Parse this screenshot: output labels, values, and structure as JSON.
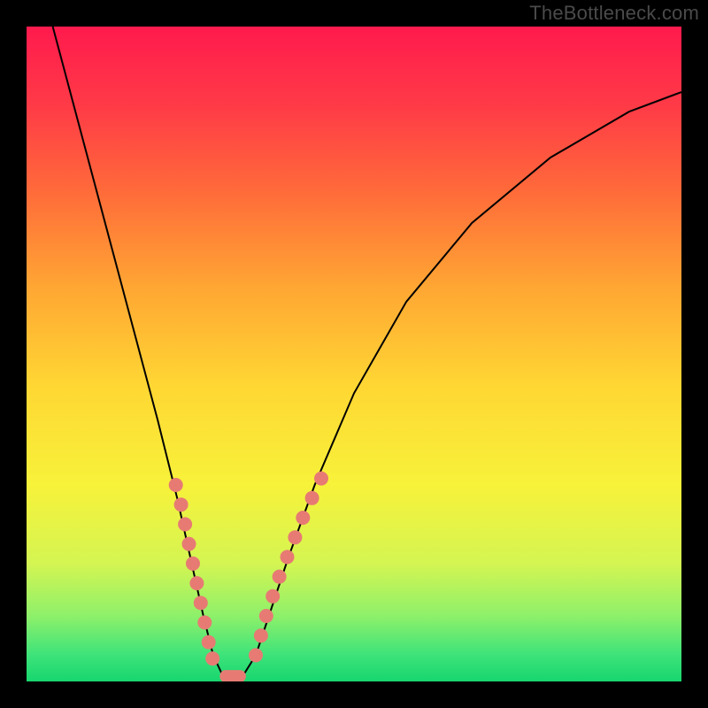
{
  "watermark": "TheBottleneck.com",
  "chart_data": {
    "type": "line",
    "title": "",
    "xlabel": "",
    "ylabel": "",
    "xlim": [
      0,
      100
    ],
    "ylim": [
      0,
      100
    ],
    "grid": false,
    "notes": "Vertical rainbow gradient background (red top → green bottom) with black V-shaped curve. Left arm starts top-left, right arm asymptotes near top-right. Salmon dot markers along lower portion of both arms and a short flat segment at the bottom (vertex).",
    "series": [
      {
        "name": "curve",
        "style": "black-line",
        "points": [
          {
            "x": 4,
            "y": 100
          },
          {
            "x": 8,
            "y": 85
          },
          {
            "x": 12,
            "y": 70
          },
          {
            "x": 16,
            "y": 55
          },
          {
            "x": 20,
            "y": 40
          },
          {
            "x": 23,
            "y": 28
          },
          {
            "x": 25,
            "y": 19
          },
          {
            "x": 27,
            "y": 10
          },
          {
            "x": 28.5,
            "y": 4
          },
          {
            "x": 30,
            "y": 0.8
          },
          {
            "x": 33,
            "y": 0.8
          },
          {
            "x": 35,
            "y": 4
          },
          {
            "x": 37,
            "y": 10
          },
          {
            "x": 40,
            "y": 19
          },
          {
            "x": 44,
            "y": 30
          },
          {
            "x": 50,
            "y": 44
          },
          {
            "x": 58,
            "y": 58
          },
          {
            "x": 68,
            "y": 70
          },
          {
            "x": 80,
            "y": 80
          },
          {
            "x": 92,
            "y": 87
          },
          {
            "x": 100,
            "y": 90
          }
        ]
      },
      {
        "name": "markers-left-arm",
        "style": "salmon-dots",
        "points": [
          {
            "x": 22.8,
            "y": 30
          },
          {
            "x": 23.6,
            "y": 27
          },
          {
            "x": 24.2,
            "y": 24
          },
          {
            "x": 24.8,
            "y": 21
          },
          {
            "x": 25.4,
            "y": 18
          },
          {
            "x": 26.0,
            "y": 15
          },
          {
            "x": 26.6,
            "y": 12
          },
          {
            "x": 27.2,
            "y": 9
          },
          {
            "x": 27.8,
            "y": 6
          },
          {
            "x": 28.4,
            "y": 3.5
          }
        ]
      },
      {
        "name": "markers-right-arm",
        "style": "salmon-dots",
        "points": [
          {
            "x": 35.0,
            "y": 4
          },
          {
            "x": 35.8,
            "y": 7
          },
          {
            "x": 36.6,
            "y": 10
          },
          {
            "x": 37.6,
            "y": 13
          },
          {
            "x": 38.6,
            "y": 16
          },
          {
            "x": 39.8,
            "y": 19
          },
          {
            "x": 41.0,
            "y": 22
          },
          {
            "x": 42.2,
            "y": 25
          },
          {
            "x": 43.6,
            "y": 28
          },
          {
            "x": 45.0,
            "y": 31
          }
        ]
      },
      {
        "name": "markers-vertex",
        "style": "salmon-bar",
        "points": [
          {
            "x": 29.5,
            "y": 0.8
          },
          {
            "x": 33.5,
            "y": 0.8
          }
        ]
      }
    ],
    "background_gradient_stops": [
      {
        "offset": 0.0,
        "color": "#ff1a4d"
      },
      {
        "offset": 0.12,
        "color": "#ff3a47"
      },
      {
        "offset": 0.25,
        "color": "#ff6a3a"
      },
      {
        "offset": 0.4,
        "color": "#ffa733"
      },
      {
        "offset": 0.55,
        "color": "#ffd733"
      },
      {
        "offset": 0.7,
        "color": "#f7f23a"
      },
      {
        "offset": 0.82,
        "color": "#d4f552"
      },
      {
        "offset": 0.9,
        "color": "#8ef06a"
      },
      {
        "offset": 0.96,
        "color": "#3de37a"
      },
      {
        "offset": 1.0,
        "color": "#17d66e"
      }
    ],
    "marker_color": "#e77b74",
    "curve_color": "#000000"
  }
}
